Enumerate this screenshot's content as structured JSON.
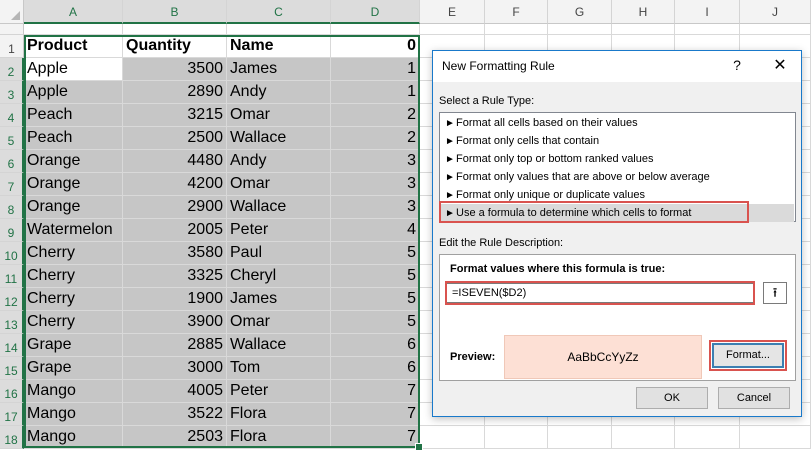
{
  "columns": [
    "A",
    "B",
    "C",
    "D",
    "E",
    "F",
    "G",
    "H",
    "I",
    "J"
  ],
  "rows": [
    "1",
    "2",
    "3",
    "4",
    "5",
    "6",
    "7",
    "8",
    "9",
    "10",
    "11",
    "12",
    "13",
    "14",
    "15",
    "16",
    "17",
    "18"
  ],
  "header": {
    "product": "Product",
    "quantity": "Quantity",
    "name": "Name",
    "d": "0"
  },
  "data": [
    {
      "product": "Apple",
      "quantity": "3500",
      "name": "James",
      "d": "1"
    },
    {
      "product": "Apple",
      "quantity": "2890",
      "name": "Andy",
      "d": "1"
    },
    {
      "product": "Peach",
      "quantity": "3215",
      "name": "Omar",
      "d": "2"
    },
    {
      "product": "Peach",
      "quantity": "2500",
      "name": "Wallace",
      "d": "2"
    },
    {
      "product": "Orange",
      "quantity": "4480",
      "name": "Andy",
      "d": "3"
    },
    {
      "product": "Orange",
      "quantity": "4200",
      "name": "Omar",
      "d": "3"
    },
    {
      "product": "Orange",
      "quantity": "2900",
      "name": "Wallace",
      "d": "3"
    },
    {
      "product": "Watermelon",
      "quantity": "2005",
      "name": "Peter",
      "d": "4"
    },
    {
      "product": "Cherry",
      "quantity": "3580",
      "name": "Paul",
      "d": "5"
    },
    {
      "product": "Cherry",
      "quantity": "3325",
      "name": "Cheryl",
      "d": "5"
    },
    {
      "product": "Cherry",
      "quantity": "1900",
      "name": "James",
      "d": "5"
    },
    {
      "product": "Cherry",
      "quantity": "3900",
      "name": "Omar",
      "d": "5"
    },
    {
      "product": "Grape",
      "quantity": "2885",
      "name": "Wallace",
      "d": "6"
    },
    {
      "product": "Grape",
      "quantity": "3000",
      "name": "Tom",
      "d": "6"
    },
    {
      "product": "Mango",
      "quantity": "4005",
      "name": "Peter",
      "d": "7"
    },
    {
      "product": "Mango",
      "quantity": "3522",
      "name": "Flora",
      "d": "7"
    },
    {
      "product": "Mango",
      "quantity": "2503",
      "name": "Flora",
      "d": "7"
    }
  ],
  "dialog": {
    "title": "New Formatting Rule",
    "help": "?",
    "close": "✕",
    "select_rule_label": "Select a Rule Type:",
    "rule_types": [
      "Format all cells based on their values",
      "Format only cells that contain",
      "Format only top or bottom ranked values",
      "Format only values that are above or below average",
      "Format only unique or duplicate values",
      "Use a formula to determine which cells to format"
    ],
    "edit_rule_label": "Edit the Rule Description:",
    "formula_label": "Format values where this formula is true:",
    "formula_value": "=ISEVEN($D2)",
    "preview_label": "Preview:",
    "preview_text": "AaBbCcYyZz",
    "format_button": "Format...",
    "ok_button": "OK",
    "cancel_button": "Cancel"
  },
  "colors": {
    "selection_green": "#217346",
    "row_shade": "#c6c6c6",
    "preview_fill": "#fde0d5",
    "highlight_red": "#d9534f",
    "dialog_border": "#1979ca"
  }
}
